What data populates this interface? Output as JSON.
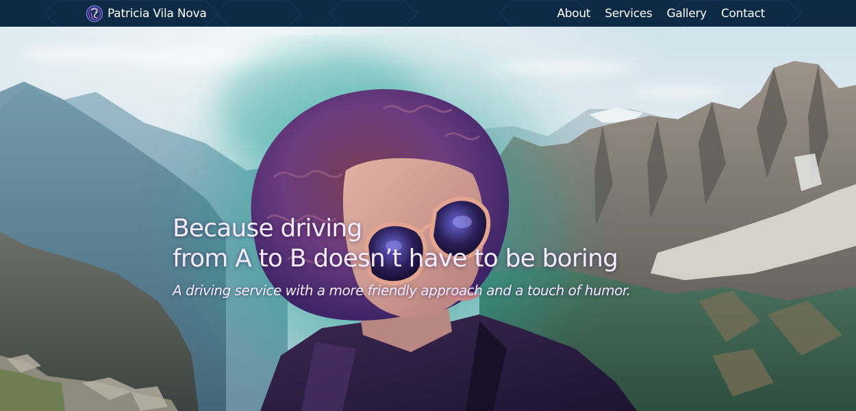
{
  "nav": {
    "brand": {
      "logo_icon": "purple-line-art-face-logo-icon",
      "name": "Patricia Vila Nova"
    },
    "links": [
      {
        "label": "About"
      },
      {
        "label": "Services"
      },
      {
        "label": "Gallery"
      },
      {
        "label": "Contact"
      }
    ]
  },
  "hero": {
    "background": "mountain-landscape-with-portrait-of-curly-haired-person-in-sunglasses",
    "headline_line1": "Because driving",
    "headline_line2": "from A to B doesn’t have to be boring",
    "tagline": "A driving service with a more friendly approach and a touch of humor."
  },
  "colors": {
    "nav_background": "#0c2a44",
    "nav_text": "#ffffff",
    "hero_text": "#f4ecff",
    "accent_purple": "#6b3fa0",
    "accent_teal": "#3fb3a6"
  }
}
